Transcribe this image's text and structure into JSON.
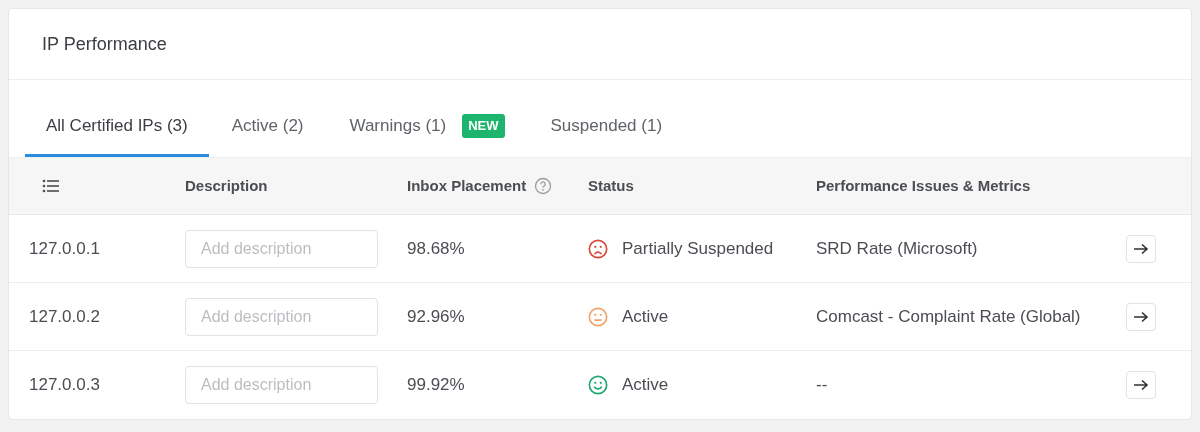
{
  "card": {
    "title": "IP Performance"
  },
  "tabs": [
    {
      "label": "All Certified IPs (3)",
      "selected": true
    },
    {
      "label": "Active (2)",
      "selected": false
    },
    {
      "label": "Warnings (1)",
      "selected": false,
      "badge": "NEW"
    },
    {
      "label": "Suspended (1)",
      "selected": false
    }
  ],
  "table": {
    "columns": [
      "Description",
      "Inbox Placement",
      "Status",
      "Performance Issues & Metrics"
    ],
    "rows": [
      {
        "ip": "127.0.0.1",
        "description": {
          "placeholder": "Add description"
        },
        "inbox_placement": "98.68%",
        "status": {
          "kind": "sad",
          "color": "#d9483b",
          "label": "Partially Suspended"
        },
        "issues": "SRD Rate (Microsoft)"
      },
      {
        "ip": "127.0.0.2",
        "description": {
          "placeholder": "Add description"
        },
        "inbox_placement": "92.96%",
        "status": {
          "kind": "neutral",
          "color": "#f0a36b",
          "label": "Active"
        },
        "issues": "Comcast - Complaint Rate (Global)"
      },
      {
        "ip": "127.0.0.3",
        "description": {
          "placeholder": "Add description"
        },
        "inbox_placement": "99.92%",
        "status": {
          "kind": "happy",
          "color": "#1fa971",
          "label": "Active"
        },
        "issues": "--"
      }
    ]
  }
}
